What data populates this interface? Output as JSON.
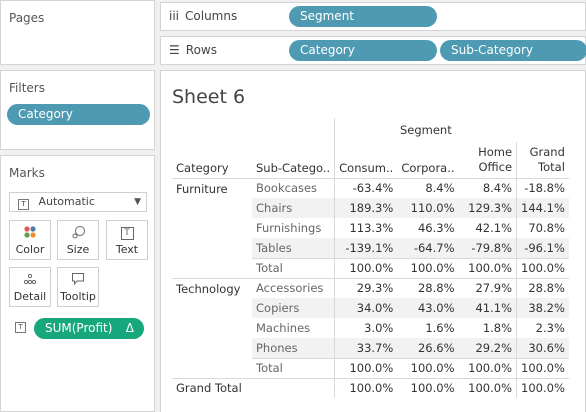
{
  "pages": {
    "title": "Pages"
  },
  "filters": {
    "title": "Filters",
    "pill": "Category"
  },
  "marks": {
    "title": "Marks",
    "type_label": "Automatic",
    "buttons": [
      {
        "label": "Color"
      },
      {
        "label": "Size"
      },
      {
        "label": "Text"
      },
      {
        "label": "Detail"
      },
      {
        "label": "Tooltip"
      }
    ],
    "measure_pill": "SUM(Profit)",
    "measure_delta": "Δ"
  },
  "columns_shelf": {
    "label": "Columns",
    "pills": [
      "Segment"
    ]
  },
  "rows_shelf": {
    "label": "Rows",
    "pills": [
      "Category",
      "Sub-Category"
    ]
  },
  "sheet": {
    "title": "Sheet 6"
  },
  "table": {
    "segment_header": "Segment",
    "row_headers": [
      "Category",
      "Sub-Catego.."
    ],
    "columns": [
      "Consum..",
      "Corpora..",
      "Home Office",
      "Grand Total"
    ],
    "groups": [
      {
        "category": "Furniture",
        "rows": [
          {
            "sub": "Bookcases",
            "values": [
              "-63.4%",
              "8.4%",
              "8.4%",
              "-18.8%"
            ]
          },
          {
            "sub": "Chairs",
            "values": [
              "189.3%",
              "110.0%",
              "129.3%",
              "144.1%"
            ]
          },
          {
            "sub": "Furnishings",
            "values": [
              "113.3%",
              "46.3%",
              "42.1%",
              "70.8%"
            ]
          },
          {
            "sub": "Tables",
            "values": [
              "-139.1%",
              "-64.7%",
              "-79.8%",
              "-96.1%"
            ]
          },
          {
            "sub": "Total",
            "values": [
              "100.0%",
              "100.0%",
              "100.0%",
              "100.0%"
            ]
          }
        ]
      },
      {
        "category": "Technology",
        "rows": [
          {
            "sub": "Accessories",
            "values": [
              "29.3%",
              "28.8%",
              "27.9%",
              "28.8%"
            ]
          },
          {
            "sub": "Copiers",
            "values": [
              "34.0%",
              "43.0%",
              "41.1%",
              "38.2%"
            ]
          },
          {
            "sub": "Machines",
            "values": [
              "3.0%",
              "1.6%",
              "1.8%",
              "2.3%"
            ]
          },
          {
            "sub": "Phones",
            "values": [
              "33.7%",
              "26.6%",
              "29.2%",
              "30.6%"
            ]
          },
          {
            "sub": "Total",
            "values": [
              "100.0%",
              "100.0%",
              "100.0%",
              "100.0%"
            ]
          }
        ]
      }
    ],
    "grand_total": {
      "label": "Grand Total",
      "values": [
        "100.0%",
        "100.0%",
        "100.0%",
        "100.0%"
      ]
    }
  }
}
